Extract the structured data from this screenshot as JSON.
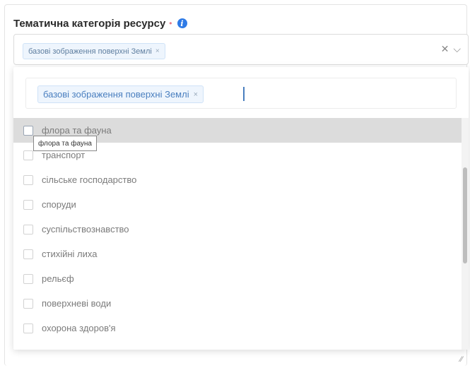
{
  "field": {
    "label": "Тематична категорія ресурсу",
    "required_mark": "•",
    "info_icon": "i"
  },
  "select": {
    "selected_chip": "базові зображення поверхні Землі",
    "chip_remove": "×",
    "clear_icon": "✕",
    "dropdown_icon": "⌵"
  },
  "search": {
    "chip_label": "базові зображення поверхні Землі",
    "chip_remove": "×"
  },
  "options": [
    {
      "label": "флора та фауна"
    },
    {
      "label": "транспорт"
    },
    {
      "label": "сільське господарство"
    },
    {
      "label": "споруди"
    },
    {
      "label": "суспільствознавство"
    },
    {
      "label": "стихійні лиха"
    },
    {
      "label": "рельєф"
    },
    {
      "label": "поверхневі води"
    },
    {
      "label": "охорона здоров'я"
    }
  ],
  "tooltip": "флора та фауна",
  "resize_glyph": "⁄⁄"
}
